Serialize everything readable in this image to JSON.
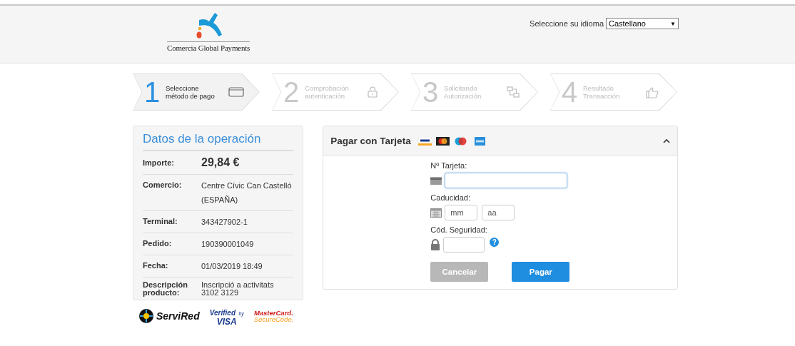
{
  "header": {
    "logo_text": "Comercia Global Payments",
    "language_label": "Seleccione su idioma",
    "language_value": "Castellano",
    "language_arrow": "▼"
  },
  "steps": [
    {
      "number": "1",
      "lines": [
        "Seleccione",
        "método de pago"
      ],
      "selected": true
    },
    {
      "number": "2",
      "lines": [
        "Comprobación",
        "autenticación"
      ],
      "selected": false
    },
    {
      "number": "3",
      "lines": [
        "Solicitando",
        "Autorización"
      ],
      "selected": false
    },
    {
      "number": "4",
      "lines": [
        "Resultado",
        "Transacción"
      ],
      "selected": false
    }
  ],
  "operation": {
    "title": "Datos de la operación",
    "rows": [
      {
        "kind": "amount",
        "label": "Importe:",
        "value": [
          "29,84 €"
        ]
      },
      {
        "kind": "text",
        "label": "Comercio:",
        "value": [
          "Centre Cívic Can Castelló",
          "(ESPAÑA)"
        ]
      },
      {
        "kind": "text",
        "label": "Terminal:",
        "value": [
          "343427902-1"
        ]
      },
      {
        "kind": "text",
        "label": "Pedido:",
        "value": [
          "190390001049"
        ]
      },
      {
        "kind": "text",
        "label": "Fecha:",
        "value": [
          "01/03/2019  18:49"
        ]
      },
      {
        "kind": "compact",
        "label": "Descripción producto:",
        "value": [
          "Inscripció a activitats",
          "3102 3129"
        ]
      }
    ]
  },
  "seals": {
    "servired": "ServiRed",
    "visa_top": "Verified",
    "visa_by": "by",
    "visa_bottom": "VISA",
    "mc_top": "MasterCard.",
    "mc_bottom": "SecureCode."
  },
  "card_panel": {
    "title": "Pagar con Tarjeta",
    "expanded": true,
    "card_number": {
      "label": "Nº Tarjeta:",
      "focused": true
    },
    "expiry": {
      "label": "Caducidad:",
      "month_placeholder": "mm",
      "year_placeholder": "aa"
    },
    "security": {
      "label": "Cód. Seguridad:",
      "help": "?"
    },
    "buttons": [
      {
        "kind": "cancel",
        "label": "Cancelar",
        "disabled": true
      },
      {
        "kind": "submit",
        "label": "Pagar",
        "disabled": false
      }
    ]
  }
}
